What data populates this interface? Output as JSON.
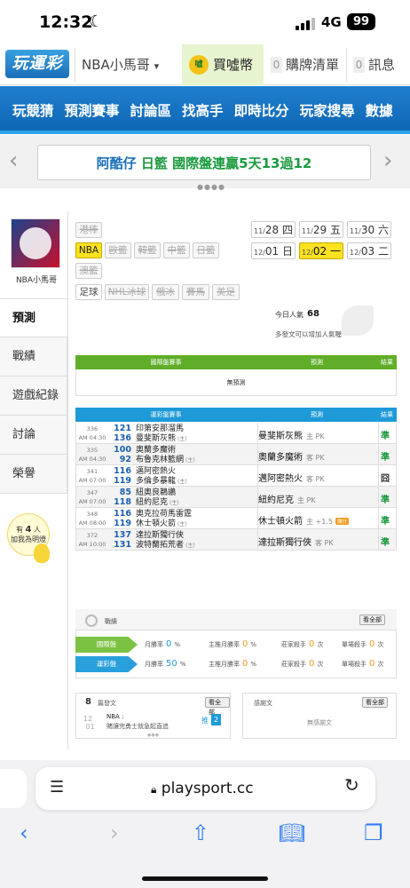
{
  "status_bar": {
    "time": "12:32",
    "network": "4G",
    "battery": "99"
  },
  "header": {
    "logo": "玩運彩",
    "nickname": "NBA小馬哥",
    "nickname_caret": "▾",
    "coin_icon": "coin-icon",
    "coin_label": "買噓幣",
    "cart_count": "0",
    "cart_label": "購牌清單",
    "msg_count": "0",
    "msg_label": "訊息"
  },
  "nav": {
    "items": [
      "玩競猜",
      "預測賽事",
      "討論區",
      "找高手",
      "即時比分",
      "玩家搜尋",
      "數據"
    ]
  },
  "ticker": {
    "name": "阿酷仔",
    "team": "日籃",
    "rest": "國際盤連贏5天13過12"
  },
  "profile": {
    "username": "NBA小馬哥"
  },
  "sidebar": {
    "items": [
      "預測",
      "戰績",
      "遊戲紀錄",
      "討論",
      "榮譽"
    ]
  },
  "fans": {
    "prefix": "有",
    "count": "4",
    "suffix": "人",
    "label": "加我為明燈"
  },
  "leagues": {
    "row1": [
      "港棒"
    ],
    "row2": [
      "NBA",
      "歐籃",
      "韓籃",
      "中籃",
      "日籃"
    ],
    "row3": [
      "澳籃"
    ],
    "row4": [
      "足球",
      "NHL冰球",
      "俄冰",
      "賽馬",
      "美足"
    ],
    "active": "NBA"
  },
  "dates": [
    {
      "day": "11/",
      "num": "28",
      "wd": "四"
    },
    {
      "day": "11/",
      "num": "29",
      "wd": "五"
    },
    {
      "day": "11/",
      "num": "30",
      "wd": "六"
    },
    {
      "day": "12/",
      "num": "01",
      "wd": "日"
    },
    {
      "day": "12/",
      "num": "02",
      "wd": "一"
    },
    {
      "day": "12/",
      "num": "03",
      "wd": "二"
    }
  ],
  "popularity": {
    "label": "今日人氣",
    "value": "68",
    "note": "多發文可以增加人氣喔~"
  },
  "intl_table": {
    "col_game": "國際盤賽事",
    "col_pick": "預測",
    "col_result": "結果",
    "empty": "無預測"
  },
  "lottery_table": {
    "col_game": "運彩盤賽事",
    "col_pick": "預測",
    "col_result": "結果",
    "games": [
      {
        "no": "336",
        "time": "AM 04:30",
        "away_score": "121",
        "away": "印第安那溜馬",
        "home_score": "136",
        "home": "曼斐斯灰熊",
        "home_mark": "(主)",
        "pick": "曼斐斯灰熊",
        "pick_side": "主 PK",
        "result": "準",
        "result_color": "#1a9a3e",
        "badge": ""
      },
      {
        "no": "335",
        "time": "AM 04:30",
        "away_score": "100",
        "away": "奧蘭多魔術",
        "home_score": "92",
        "home": "布魯克林籃網",
        "home_mark": "(主)",
        "pick": "奧蘭多魔術",
        "pick_side": "客 PK",
        "result": "準",
        "result_color": "#1a9a3e",
        "badge": ""
      },
      {
        "no": "341",
        "time": "AM 07:00",
        "away_score": "116",
        "away": "邁阿密熱火",
        "home_score": "119",
        "home": "多倫多暴龍",
        "home_mark": "(主)",
        "pick": "邁阿密熱火",
        "pick_side": "客 PK",
        "result": "囧",
        "result_color": "#333",
        "badge": ""
      },
      {
        "no": "347",
        "time": "AM 07:00",
        "away_score": "85",
        "away": "紐奧良鵜鶘",
        "home_score": "118",
        "home": "紐約尼克",
        "home_mark": "(主)",
        "pick": "紐約尼克",
        "pick_side": "主 PK",
        "result": "準",
        "result_color": "#1a9a3e",
        "badge": ""
      },
      {
        "no": "348",
        "time": "AM 08:00",
        "away_score": "116",
        "away": "奧克拉荷馬雷霆",
        "home_score": "119",
        "home": "休士頓火箭",
        "home_mark": "(主)",
        "pick": "休士頓火箭",
        "pick_side": "主 +1.5",
        "result": "準",
        "result_color": "#1a9a3e",
        "badge": "讓分"
      },
      {
        "no": "372",
        "time": "AM 10:00",
        "away_score": "137",
        "away": "達拉斯獨行俠",
        "home_score": "131",
        "home": "波特蘭拓荒者",
        "home_mark": "(主)",
        "pick": "達拉斯獨行俠",
        "pick_side": "客 PK",
        "result": "準",
        "result_color": "#1a9a3e",
        "badge": ""
      }
    ]
  },
  "record": {
    "title": "戰績",
    "view_all": "看全部",
    "rows": [
      {
        "tag": "國際盤",
        "color": "#7cc242",
        "win_label": "月勝率",
        "win_value": "0",
        "win_unit": "%",
        "home_label": "主推月勝率",
        "home_value": "0",
        "home_unit": "%",
        "streak_label": "莊家殺手",
        "streak_value": "0",
        "streak_unit": "次",
        "single_label": "單場殺手",
        "single_value": "0",
        "single_unit": "次"
      },
      {
        "tag": "運彩盤",
        "color": "#29a0dc",
        "win_label": "月勝率",
        "win_value": "50",
        "win_unit": "%",
        "home_label": "主推月勝率",
        "home_value": "0",
        "home_unit": "%",
        "streak_label": "莊家殺手",
        "streak_value": "0",
        "streak_unit": "次",
        "single_label": "單場殺手",
        "single_value": "0",
        "single_unit": "次"
      }
    ]
  },
  "posts": {
    "count": "8",
    "label": "篇發文",
    "view_all": "看全部",
    "date_month": "12",
    "date_day": "01",
    "post_league": "NBA :",
    "post_title": "賭讓完勇士就急起直追",
    "reply_label": "推",
    "reply_count": "2"
  },
  "fav_posts": {
    "label": "感謝文",
    "view_all": "看全部",
    "empty": "無感謝文"
  },
  "browser": {
    "url": "playsport.cc"
  }
}
